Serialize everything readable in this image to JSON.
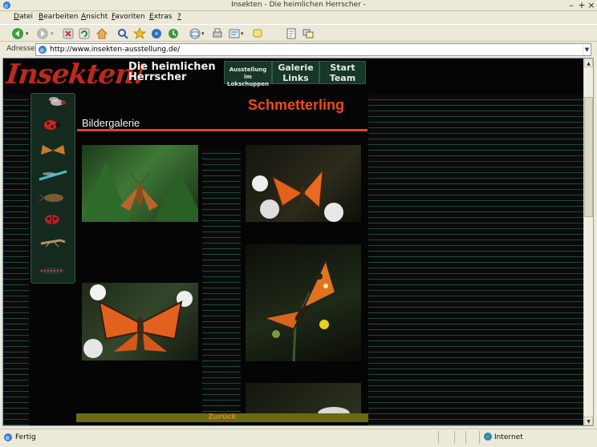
{
  "window": {
    "title": "Insekten - Die heimlichen Herrscher -",
    "controls": [
      "–",
      "+",
      "×"
    ]
  },
  "menu": [
    {
      "label": "Datei",
      "key": "D",
      "rest": "atei"
    },
    {
      "label": "Bearbeiten",
      "key": "B",
      "rest": "earbeiten"
    },
    {
      "label": "Ansicht",
      "key": "A",
      "rest": "nsicht"
    },
    {
      "label": "Favoriten",
      "key": "F",
      "rest": "avoriten"
    },
    {
      "label": "Extras",
      "key": "E",
      "rest": "xtras"
    },
    {
      "label": "?",
      "key": "?",
      "rest": ""
    }
  ],
  "address": {
    "label": "Adresse",
    "url": "http://www.insekten-ausstellung.de/"
  },
  "site": {
    "logo": "Insekten!",
    "subtitle_line1": "Die heimlichen",
    "subtitle_line2": "Herrscher",
    "nav": {
      "ausstellung": "Ausstellung im Lokschuppen",
      "galerie": "Galerie",
      "links": "Links",
      "start": "Start",
      "team": "Team"
    },
    "heading": "Schmetterling",
    "gallery_title": "Bildergalerie",
    "back": "Zurück"
  },
  "status": {
    "text": "Fertig",
    "zone": "Internet"
  },
  "colors": {
    "accent": "#ee4a1a",
    "logo": "#c0281b",
    "nav_bg": "#163826",
    "stripe": "#1f4a3a"
  }
}
